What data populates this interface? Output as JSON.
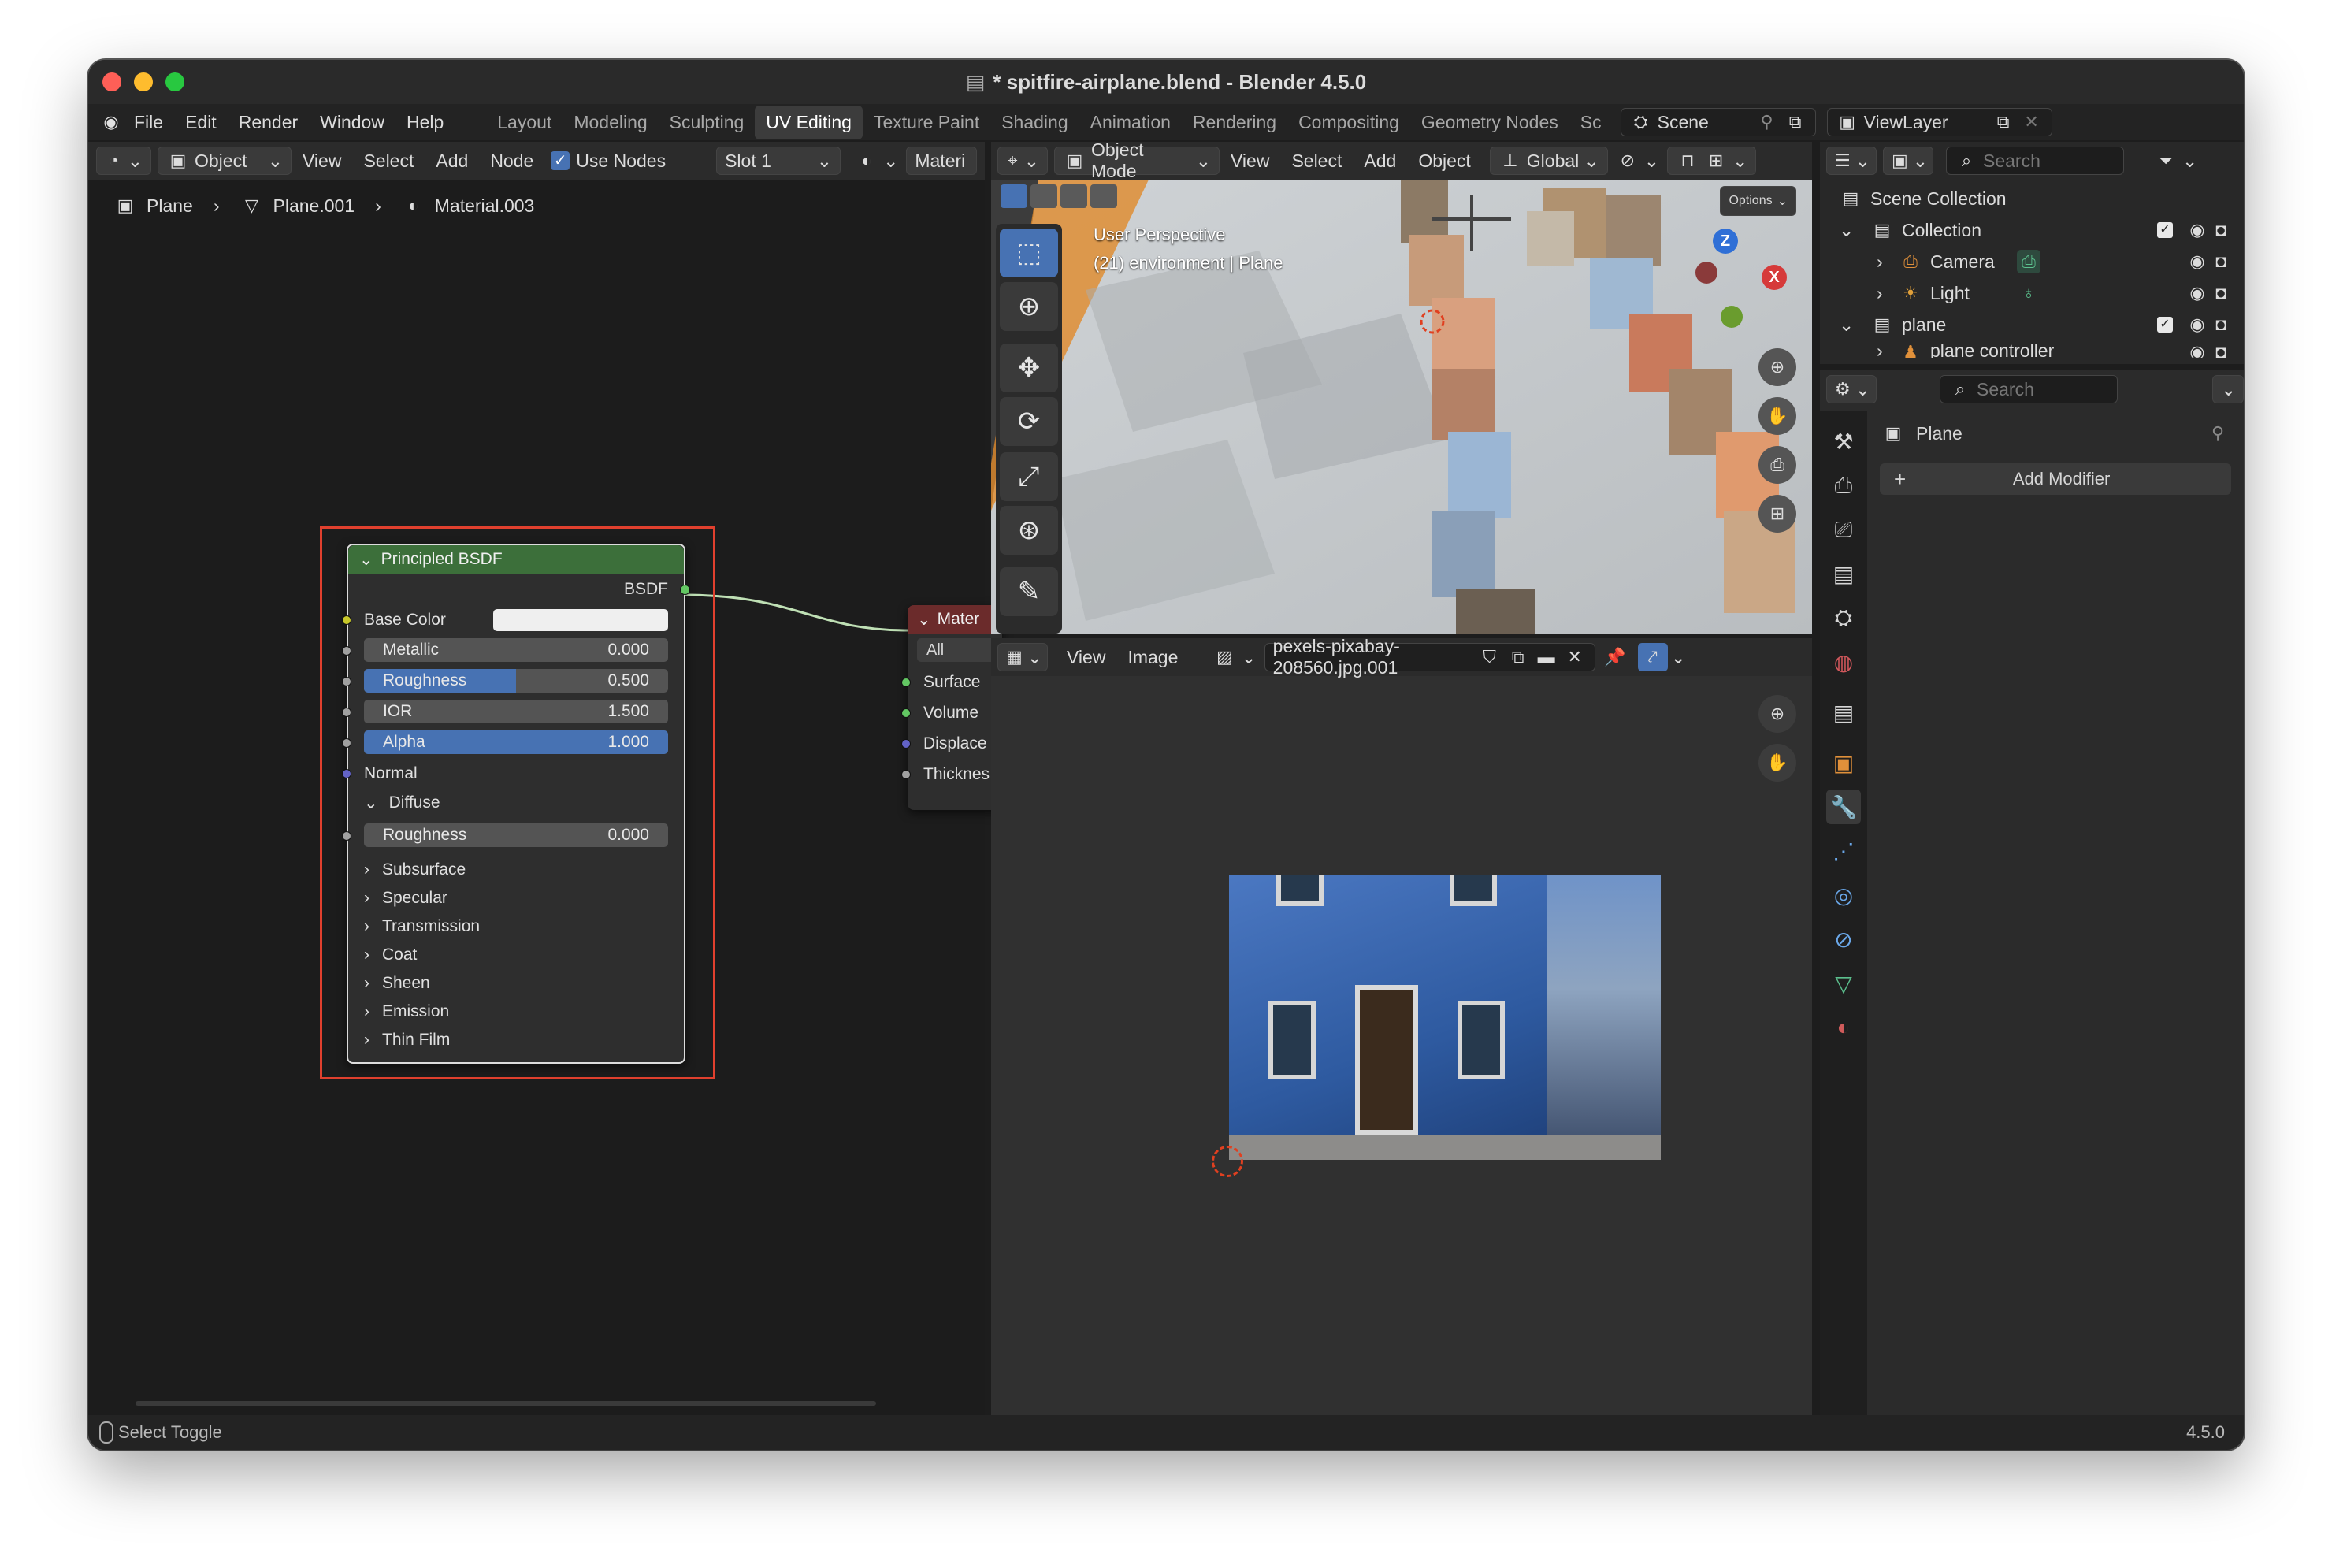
{
  "window": {
    "title": "* spitfire-airplane.blend - Blender 4.5.0"
  },
  "menus": [
    "File",
    "Edit",
    "Render",
    "Window",
    "Help"
  ],
  "workspaces": [
    "Layout",
    "Modeling",
    "Sculpting",
    "UV Editing",
    "Texture Paint",
    "Shading",
    "Animation",
    "Rendering",
    "Compositing",
    "Geometry Nodes",
    "Sc"
  ],
  "active_workspace": "UV Editing",
  "scene": {
    "label": "Scene"
  },
  "view_layer": {
    "label": "ViewLayer"
  },
  "node_editor": {
    "header": {
      "object_mode": "Object",
      "view": "View",
      "select": "Select",
      "add": "Add",
      "node": "Node",
      "use_nodes": "Use Nodes",
      "slot": "Slot 1",
      "material_trunc": "Materi"
    },
    "breadcrumb": [
      "Plane",
      "Plane.001",
      "Material.003"
    ],
    "bsdf": {
      "title": "Principled BSDF",
      "output": "BSDF",
      "base_color": "Base Color",
      "fields": [
        {
          "label": "Metallic",
          "value": "0.000",
          "fill": 0
        },
        {
          "label": "Roughness",
          "value": "0.500",
          "fill": 0.5
        },
        {
          "label": "IOR",
          "value": "1.500",
          "fill": 0
        },
        {
          "label": "Alpha",
          "value": "1.000",
          "fill": 1
        }
      ],
      "normal": "Normal",
      "diffuse": "Diffuse",
      "diffuse_roughness": {
        "label": "Roughness",
        "value": "0.000"
      },
      "panels": [
        "Subsurface",
        "Specular",
        "Transmission",
        "Coat",
        "Sheen",
        "Emission",
        "Thin Film"
      ]
    },
    "output_node": {
      "title": "Mater",
      "target": "All",
      "inputs": [
        "Surface",
        "Volume",
        "Displace",
        "Thicknes"
      ]
    }
  },
  "viewport": {
    "header": {
      "mode": "Object Mode",
      "view": "View",
      "select": "Select",
      "add": "Add",
      "object": "Object",
      "orientation": "Global",
      "options": "Options"
    },
    "overlay_title": "User Perspective",
    "overlay_sub": "(21) environment | Plane",
    "gizmo": {
      "x": "X",
      "z": "Z"
    }
  },
  "image_editor": {
    "header": {
      "view": "View",
      "image": "Image",
      "filename": "pexels-pixabay-208560.jpg.001"
    }
  },
  "outliner": {
    "search_placeholder": "Search",
    "items": [
      {
        "label": "Scene Collection",
        "indent": 0
      },
      {
        "label": "Collection",
        "indent": 1
      },
      {
        "label": "Camera",
        "indent": 2
      },
      {
        "label": "Light",
        "indent": 2
      },
      {
        "label": "plane",
        "indent": 1
      },
      {
        "label": "plane controller",
        "indent": 2
      }
    ]
  },
  "properties": {
    "search_placeholder": "Search",
    "object_name": "Plane",
    "add_modifier": "Add Modifier"
  },
  "statusbar": {
    "left": "Select Toggle",
    "version": "4.5.0"
  },
  "colors": {
    "accent": "#4772b3",
    "node_header_bsdf": "#3c6f3a",
    "node_header_output": "#6b2b2b",
    "highlight_box": "#e0402e"
  }
}
